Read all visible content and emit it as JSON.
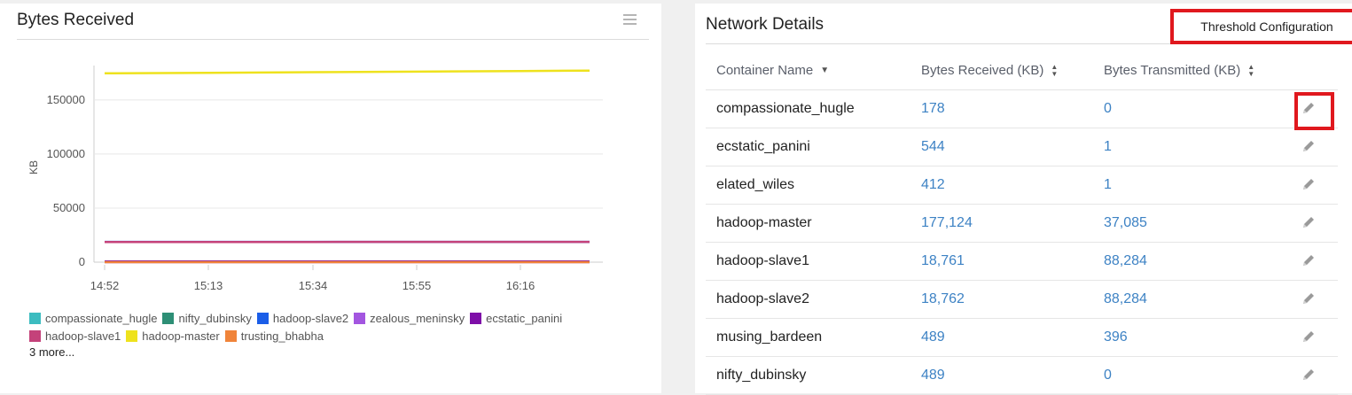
{
  "left_panel": {
    "title": "Bytes Received",
    "menu_icon": "hamburger-menu-icon"
  },
  "chart_data": {
    "type": "line",
    "title": "",
    "ylabel": "KB",
    "xlabel": "",
    "x_ticks": [
      "14:52",
      "15:13",
      "15:34",
      "15:55",
      "16:16"
    ],
    "y_ticks": [
      0,
      50000,
      100000,
      150000
    ],
    "ylim": [
      0,
      190000
    ],
    "grid": true,
    "series": [
      {
        "name": "compassionate_hugle",
        "color": "#3cbcc0",
        "values": [
          178,
          178,
          178,
          178,
          178,
          178
        ]
      },
      {
        "name": "nifty_dubinsky",
        "color": "#2e8f76",
        "values": [
          489,
          489,
          489,
          489,
          489,
          489
        ]
      },
      {
        "name": "hadoop-slave2",
        "color": "#1b5ee8",
        "values": [
          18762,
          18762,
          18762,
          18762,
          18762,
          18762
        ]
      },
      {
        "name": "zealous_meninsky",
        "color": "#a356e0",
        "values": [
          0,
          0,
          0,
          0,
          0,
          0
        ]
      },
      {
        "name": "ecstatic_panini",
        "color": "#7e0fa8",
        "values": [
          544,
          544,
          544,
          544,
          544,
          544
        ]
      },
      {
        "name": "hadoop-slave1",
        "color": "#c4427a",
        "values": [
          18600,
          18650,
          18700,
          18720,
          18740,
          18761
        ]
      },
      {
        "name": "hadoop-master",
        "color": "#eee21d",
        "values": [
          174600,
          175100,
          175700,
          176200,
          176700,
          177124
        ]
      },
      {
        "name": "trusting_bhabha",
        "color": "#f0843a",
        "values": [
          0,
          0,
          0,
          0,
          0,
          0
        ]
      }
    ],
    "x_points": [
      "14:52",
      "15:13",
      "15:34",
      "15:55",
      "16:16",
      "16:30"
    ],
    "legend_more": "3 more..."
  },
  "right_panel": {
    "title": "Network Details",
    "threshold_button": "Threshold Configuration",
    "columns": {
      "name": "Container Name",
      "received": "Bytes Received (KB)",
      "transmitted": "Bytes Transmitted (KB)"
    },
    "rows": [
      {
        "name": "compassionate_hugle",
        "received": "178",
        "transmitted": "0"
      },
      {
        "name": "ecstatic_panini",
        "received": "544",
        "transmitted": "1"
      },
      {
        "name": "elated_wiles",
        "received": "412",
        "transmitted": "1"
      },
      {
        "name": "hadoop-master",
        "received": "177,124",
        "transmitted": "37,085"
      },
      {
        "name": "hadoop-slave1",
        "received": "18,761",
        "transmitted": "88,284"
      },
      {
        "name": "hadoop-slave2",
        "received": "18,762",
        "transmitted": "88,284"
      },
      {
        "name": "musing_bardeen",
        "received": "489",
        "transmitted": "396"
      },
      {
        "name": "nifty_dubinsky",
        "received": "489",
        "transmitted": "0"
      }
    ],
    "edit_icon": "pencil-edit-icon",
    "highlight_color": "#e0181e"
  }
}
